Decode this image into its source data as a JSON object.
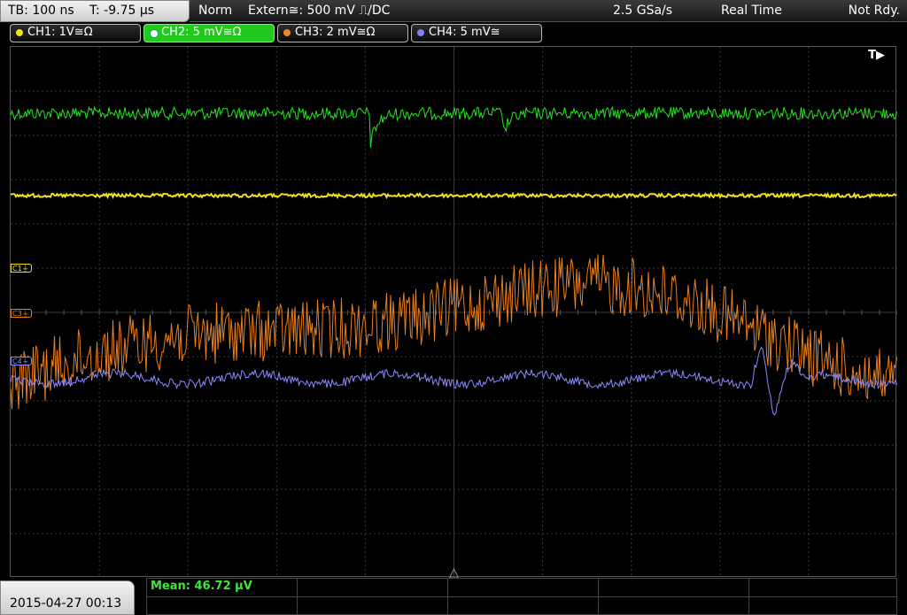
{
  "topbar": {
    "timebase": "TB: 100 ns",
    "trigger_offset": "T: -9.75 µs",
    "mode": "Norm",
    "trigger_source": "Extern≅: 500 mV ⎍/DC",
    "sample_rate": "2.5 GSa/s",
    "acq_mode": "Real Time",
    "state": "Not Rdy."
  },
  "channels": [
    {
      "label": "CH1: 1V≅Ω",
      "color": "#f0e020",
      "active": false
    },
    {
      "label": "CH2: 5 mV≅Ω",
      "color": "#22c81e",
      "active": true
    },
    {
      "label": "CH3: 2 mV≅Ω",
      "color": "#f08a20",
      "active": false
    },
    {
      "label": "CH4: 5 mV≅",
      "color": "#8080ff",
      "active": false
    }
  ],
  "screen": {
    "trigger_marker": "T▶",
    "markers": {
      "c1": "C1",
      "c3": "C3",
      "c4": "C4"
    }
  },
  "status_bar": {
    "datetime": "2015-04-27 00:13",
    "measurement": "Mean: 46.72 µV"
  },
  "colors": {
    "ch1": "#f0e020",
    "ch2": "#22e81e",
    "ch3": "#e8801e",
    "ch4": "#8a8aff",
    "grid": "#3a3a3a"
  }
}
